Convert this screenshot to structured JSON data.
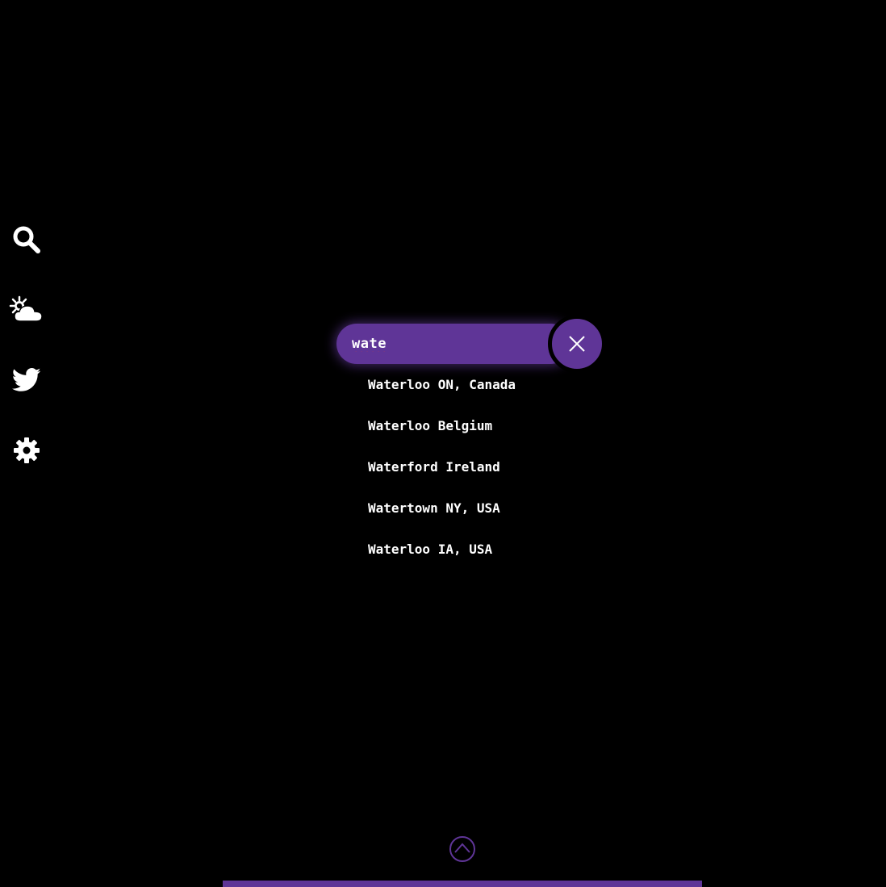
{
  "sidebar": {
    "items": [
      {
        "icon": "search-icon"
      },
      {
        "icon": "partly-cloudy-icon"
      },
      {
        "icon": "twitter-icon"
      },
      {
        "icon": "gear-icon"
      }
    ]
  },
  "search": {
    "value": "wate",
    "close_icon": "close-icon"
  },
  "suggestions": [
    "Waterloo ON, Canada",
    "Waterloo Belgium",
    "Waterford Ireland",
    "Watertown NY, USA",
    "Waterloo IA, USA"
  ],
  "footer": {
    "scroll_icon": "chevron-up-circle-icon"
  },
  "colors": {
    "accent": "#5f3597",
    "background": "#000000",
    "text": "#ffffff"
  }
}
